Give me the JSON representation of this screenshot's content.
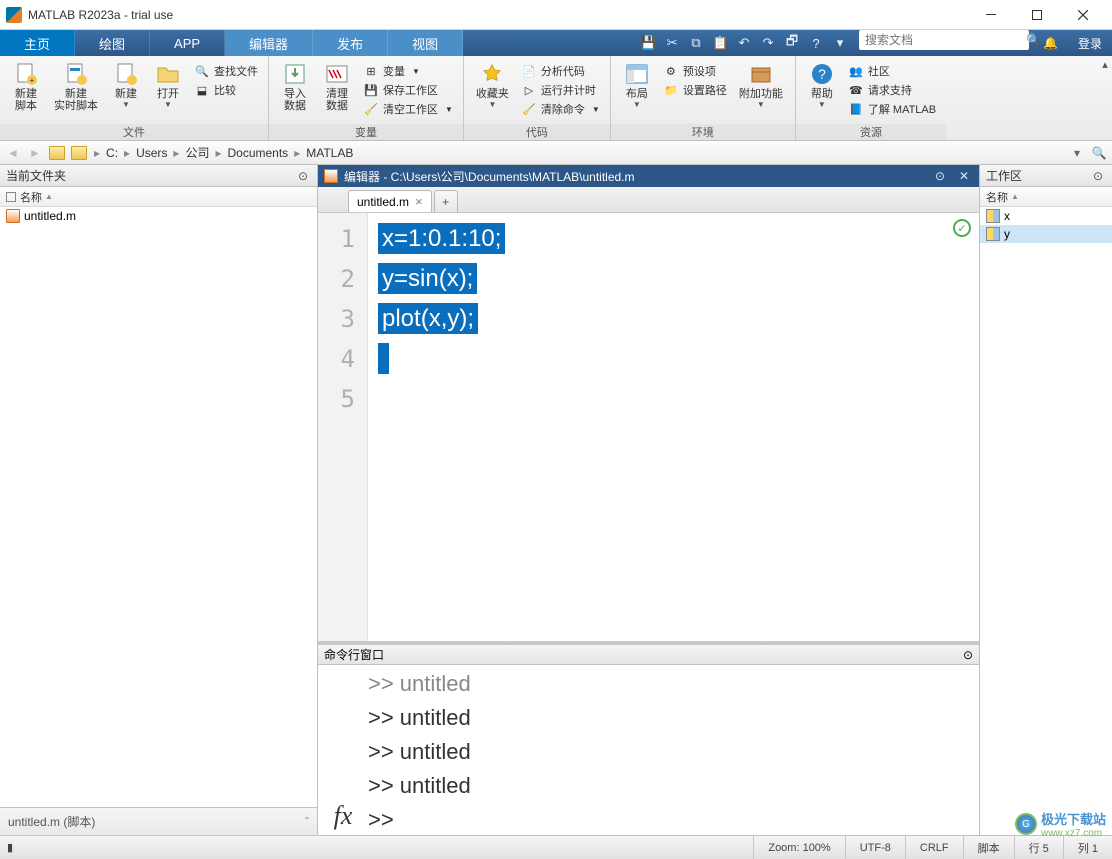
{
  "window": {
    "title": "MATLAB R2023a - trial use"
  },
  "tabs": {
    "home": "主页",
    "plots": "绘图",
    "apps": "APP",
    "editor": "编辑器",
    "publish": "发布",
    "view": "视图"
  },
  "search": {
    "placeholder": "搜索文档",
    "login": "登录"
  },
  "ribbon": {
    "file": {
      "new_script": "新建\n脚本",
      "new_live": "新建\n实时脚本",
      "new": "新建",
      "open": "打开",
      "find_files": "查找文件",
      "compare": "比较",
      "label": "文件"
    },
    "var": {
      "import": "导入\n数据",
      "clean": "清理\n数据",
      "var": "变量",
      "save_ws": "保存工作区",
      "clear_ws": "清空工作区",
      "label": "变量"
    },
    "code": {
      "fav": "收藏夹",
      "analyze": "分析代码",
      "run_time": "运行并计时",
      "clear_cmd": "清除命令",
      "label": "代码"
    },
    "env": {
      "layout": "布局",
      "prefs": "预设项",
      "setpath": "设置路径",
      "addons": "附加功能",
      "label": "环境"
    },
    "res": {
      "help": "帮助",
      "community": "社区",
      "request": "请求支持",
      "learn": "了解 MATLAB",
      "label": "资源"
    }
  },
  "address": {
    "crumbs": [
      "C:",
      "Users",
      "公司",
      "Documents",
      "MATLAB"
    ]
  },
  "current_folder": {
    "title": "当前文件夹",
    "name_col": "名称",
    "files": [
      "untitled.m"
    ],
    "detail": "untitled.m  (脚本)"
  },
  "editor": {
    "title_prefix": "编辑器 - ",
    "path": "C:\\Users\\公司\\Documents\\MATLAB\\untitled.m",
    "tab_name": "untitled.m",
    "lines": [
      "x=1:0.1:10;",
      "y=sin(x);",
      "plot(x,y);",
      "",
      ""
    ],
    "line_count": 5
  },
  "command": {
    "title": "命令行窗口",
    "history": [
      ">> untitled",
      ">> untitled",
      ">> untitled",
      ">> untitled"
    ],
    "prompt": ">> "
  },
  "workspace": {
    "title": "工作区",
    "name_col": "名称",
    "vars": [
      "x",
      "y"
    ]
  },
  "status": {
    "zoom": "Zoom: 100%",
    "encoding": "UTF-8",
    "eol": "CRLF",
    "mode": "脚本",
    "line": "行  5",
    "col": "列  1"
  },
  "watermark": {
    "text1": "极光下载站",
    "text2": "www.xz7.com"
  }
}
